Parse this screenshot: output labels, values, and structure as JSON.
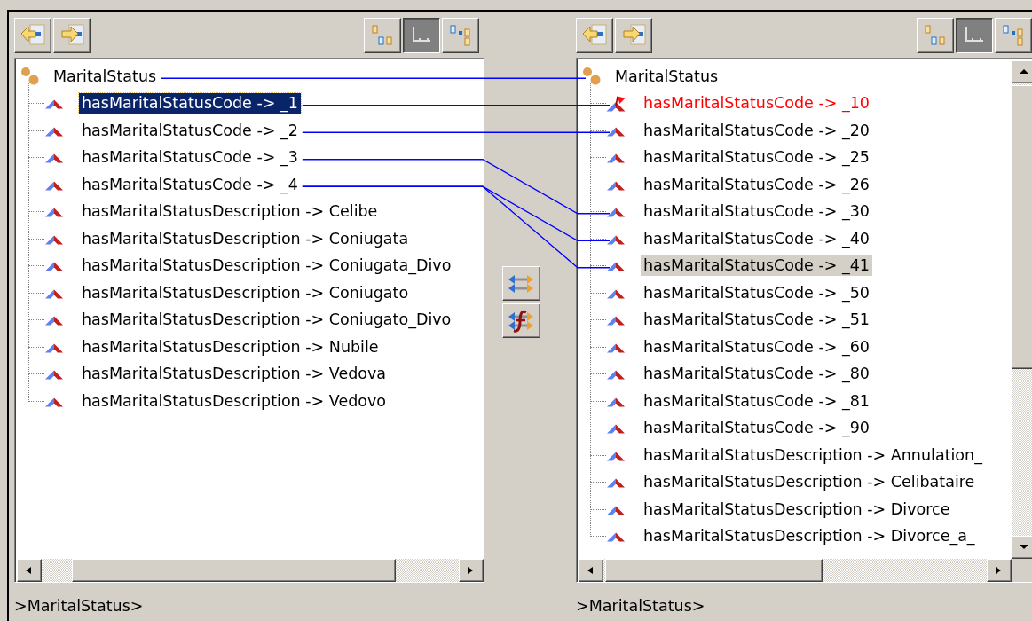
{
  "left_panel": {
    "focused": true,
    "nav_buttons": [
      {
        "kind": "back"
      },
      {
        "kind": "forward"
      }
    ],
    "view_buttons": [
      {
        "kind": "tree",
        "pressed": false
      },
      {
        "kind": "flat",
        "pressed": true
      },
      {
        "kind": "split",
        "pressed": false
      }
    ],
    "tree": {
      "label": "MaritalStatus",
      "connected": true,
      "children": [
        {
          "label": "hasMaritalStatusCode -> _1",
          "selected": true,
          "connected": true,
          "error": false
        },
        {
          "label": "hasMaritalStatusCode -> _2",
          "selected": false,
          "connected": true,
          "error": false
        },
        {
          "label": "hasMaritalStatusCode -> _3",
          "selected": false,
          "connected": true,
          "error": false
        },
        {
          "label": "hasMaritalStatusCode -> _4",
          "selected": false,
          "connected": true,
          "error": false
        },
        {
          "label": "hasMaritalStatusDescription -> Celibe",
          "selected": false,
          "connected": false,
          "error": false
        },
        {
          "label": "hasMaritalStatusDescription -> Coniugata",
          "selected": false,
          "connected": false,
          "error": false
        },
        {
          "label": "hasMaritalStatusDescription -> Coniugata_Divo",
          "selected": false,
          "connected": false,
          "error": false
        },
        {
          "label": "hasMaritalStatusDescription -> Coniugato",
          "selected": false,
          "connected": false,
          "error": false
        },
        {
          "label": "hasMaritalStatusDescription -> Coniugato_Divo",
          "selected": false,
          "connected": false,
          "error": false
        },
        {
          "label": "hasMaritalStatusDescription -> Nubile",
          "selected": false,
          "connected": false,
          "error": false
        },
        {
          "label": "hasMaritalStatusDescription -> Vedova",
          "selected": false,
          "connected": false,
          "error": false
        },
        {
          "label": "hasMaritalStatusDescription -> Vedovo",
          "selected": false,
          "connected": false,
          "error": false
        }
      ]
    },
    "status": ">MaritalStatus>"
  },
  "middle_buttons": [
    {
      "kind": "map"
    },
    {
      "kind": "function"
    }
  ],
  "right_panel": {
    "focused": false,
    "nav_buttons": [
      {
        "kind": "back"
      },
      {
        "kind": "forward"
      }
    ],
    "view_buttons": [
      {
        "kind": "tree",
        "pressed": false
      },
      {
        "kind": "flat",
        "pressed": true
      },
      {
        "kind": "split",
        "pressed": false
      }
    ],
    "tree": {
      "label": "MaritalStatus",
      "connected": true,
      "children": [
        {
          "label": "hasMaritalStatusCode -> _10",
          "selected": false,
          "connected": true,
          "error": true
        },
        {
          "label": "hasMaritalStatusCode -> _20",
          "selected": false,
          "connected": true,
          "error": false
        },
        {
          "label": "hasMaritalStatusCode -> _25",
          "selected": false,
          "connected": false,
          "error": false
        },
        {
          "label": "hasMaritalStatusCode -> _26",
          "selected": false,
          "connected": false,
          "error": false
        },
        {
          "label": "hasMaritalStatusCode -> _30",
          "selected": false,
          "connected": true,
          "error": false
        },
        {
          "label": "hasMaritalStatusCode -> _40",
          "selected": false,
          "connected": true,
          "error": false
        },
        {
          "label": "hasMaritalStatusCode -> _41",
          "selected": true,
          "connected": true,
          "error": false
        },
        {
          "label": "hasMaritalStatusCode -> _50",
          "selected": false,
          "connected": false,
          "error": false
        },
        {
          "label": "hasMaritalStatusCode -> _51",
          "selected": false,
          "connected": false,
          "error": false
        },
        {
          "label": "hasMaritalStatusCode -> _60",
          "selected": false,
          "connected": false,
          "error": false
        },
        {
          "label": "hasMaritalStatusCode -> _80",
          "selected": false,
          "connected": false,
          "error": false
        },
        {
          "label": "hasMaritalStatusCode -> _81",
          "selected": false,
          "connected": false,
          "error": false
        },
        {
          "label": "hasMaritalStatusCode -> _90",
          "selected": false,
          "connected": false,
          "error": false
        },
        {
          "label": "hasMaritalStatusDescription -> Annulation_",
          "selected": false,
          "connected": false,
          "error": false
        },
        {
          "label": "hasMaritalStatusDescription -> Celibataire",
          "selected": false,
          "connected": false,
          "error": false
        },
        {
          "label": "hasMaritalStatusDescription -> Divorce",
          "selected": false,
          "connected": false,
          "error": false
        },
        {
          "label": "hasMaritalStatusDescription -> Divorce_a_",
          "selected": false,
          "connected": false,
          "error": false
        }
      ]
    },
    "status": ">MaritalStatus>"
  }
}
